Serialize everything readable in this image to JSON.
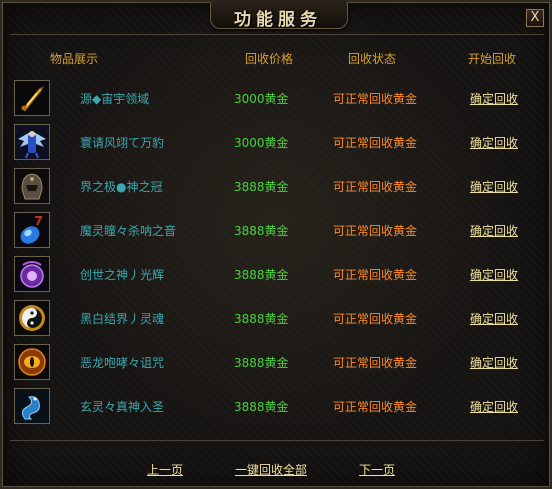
{
  "window": {
    "title": "功能服务",
    "close_label": "X"
  },
  "headers": {
    "item": "物品展示",
    "price": "回收价格",
    "status": "回收状态",
    "action": "开始回收"
  },
  "items": [
    {
      "name": "源◆宙宇领域",
      "price": "3000黄金",
      "status": "可正常回收黄金",
      "action": "确定回收",
      "icon": "golden-sword-icon"
    },
    {
      "name": "寰请风翊て万豹",
      "price": "3000黄金",
      "status": "可正常回收黄金",
      "action": "确定回收",
      "icon": "winged-armor-icon"
    },
    {
      "name": "界之极●神之冠",
      "price": "3888黄金",
      "status": "可正常回收黄金",
      "action": "确定回收",
      "icon": "dark-helmet-icon"
    },
    {
      "name": "魔灵瞳々杀呐之音",
      "price": "3888黄金",
      "status": "可正常回收黄金",
      "action": "确定回收",
      "icon": "blue-crystal-icon"
    },
    {
      "name": "创世之神丿光辉",
      "price": "3888黄金",
      "status": "可正常回收黄金",
      "action": "确定回收",
      "icon": "purple-orb-icon"
    },
    {
      "name": "黑白结界丿灵魂",
      "price": "3888黄金",
      "status": "可正常回收黄金",
      "action": "确定回收",
      "icon": "yin-yang-icon"
    },
    {
      "name": "恶龙咆哮々诅咒",
      "price": "3888黄金",
      "status": "可正常回收黄金",
      "action": "确定回收",
      "icon": "dragon-eye-icon"
    },
    {
      "name": "玄灵々真神入圣",
      "price": "3888黄金",
      "status": "可正常回收黄金",
      "action": "确定回收",
      "icon": "blue-dragon-icon"
    }
  ],
  "footer": {
    "prev": "上一页",
    "recycle_all": "一键回收全部",
    "next": "下一页"
  }
}
